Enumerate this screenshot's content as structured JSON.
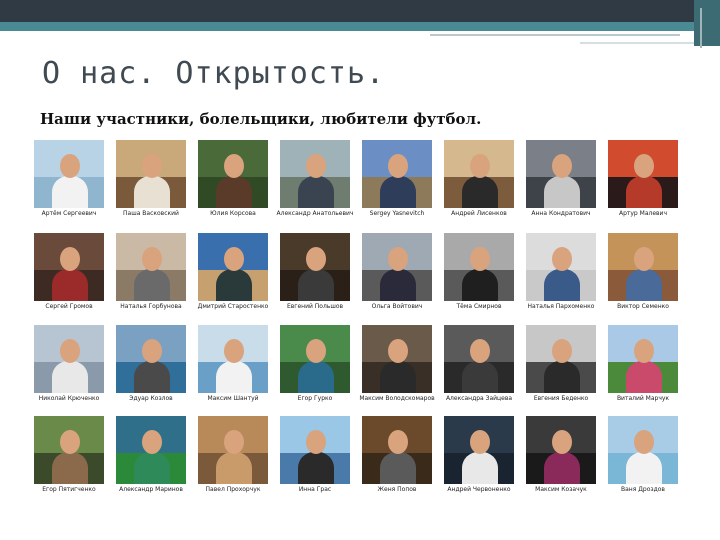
{
  "slide": {
    "title": "О нас. Открытость.",
    "subtitle": "Наши участники, болельщики, любители футбол."
  },
  "members": [
    {
      "name": "Артём Сергеевич",
      "sky": "#b8d3e6",
      "ground": "#8fb5cf",
      "shirt": "#f2f2f2"
    },
    {
      "name": "Паша Васковский",
      "sky": "#c9a97a",
      "ground": "#7a5a3a",
      "shirt": "#e8e1d3"
    },
    {
      "name": "Юлия Корсова",
      "sky": "#4a6a3a",
      "ground": "#2f4a24",
      "shirt": "#5a3b2a"
    },
    {
      "name": "Александр Анатольевич",
      "sky": "#9fb2b8",
      "ground": "#6f7d70",
      "shirt": "#3a4450"
    },
    {
      "name": "Sergey Yasnevitch",
      "sky": "#6b8fc4",
      "ground": "#8d7a5a",
      "shirt": "#2d3d5a"
    },
    {
      "name": "Андрей Лисенков",
      "sky": "#d6b88e",
      "ground": "#7d5b3d",
      "shirt": "#2a2a2a"
    },
    {
      "name": "Анна Кондратович",
      "sky": "#7a7f88",
      "ground": "#3e434a",
      "shirt": "#c7c7c7"
    },
    {
      "name": "Артур Малевич",
      "sky": "#d14b2e",
      "ground": "#2a1a1a",
      "shirt": "#b53a2a"
    },
    {
      "name": "Сергей Громов",
      "sky": "#6a4a3a",
      "ground": "#3d2a22",
      "shirt": "#9b2a2a"
    },
    {
      "name": "Наталья Горбунова",
      "sky": "#c9b9a5",
      "ground": "#8a7a66",
      "shirt": "#6a6a6a"
    },
    {
      "name": "Дмитрий Старостенко",
      "sky": "#3a6fae",
      "ground": "#c7a070",
      "shirt": "#2a3a3a"
    },
    {
      "name": "Евгений Польшов",
      "sky": "#4a3a2a",
      "ground": "#2a2018",
      "shirt": "#3a3a3a"
    },
    {
      "name": "Ольга Войтович",
      "sky": "#9fa9b3",
      "ground": "#5a5a5a",
      "shirt": "#2a2a3a"
    },
    {
      "name": "Тёма Смирнов",
      "sky": "#a9a9a9",
      "ground": "#5a5a5a",
      "shirt": "#1f1f1f"
    },
    {
      "name": "Наталья Пархоменко",
      "sky": "#dcdcdc",
      "ground": "#c9c9c9",
      "shirt": "#3a5a8a"
    },
    {
      "name": "Виктор Семенко",
      "sky": "#c4935a",
      "ground": "#8a5a3a",
      "shirt": "#4a6a9a"
    },
    {
      "name": "Николай Крюченко",
      "sky": "#b7c5d3",
      "ground": "#8a9aaa",
      "shirt": "#e8e8e8"
    },
    {
      "name": "Эдуар Козлов",
      "sky": "#7aa0c2",
      "ground": "#2f6f9a",
      "shirt": "#4a4a4a"
    },
    {
      "name": "Максим Шантуй",
      "sky": "#c9dce9",
      "ground": "#6aa0c7",
      "shirt": "#f2f2f2"
    },
    {
      "name": "Егор Гурко",
      "sky": "#4a8a4a",
      "ground": "#2f5a2f",
      "shirt": "#2a6a8a"
    },
    {
      "name": "Максим Володскомаров",
      "sky": "#6a5a4a",
      "ground": "#3a2f26",
      "shirt": "#2a2a2a"
    },
    {
      "name": "Александра Зайцева",
      "sky": "#5a5a5a",
      "ground": "#2a2a2a",
      "shirt": "#3a3a3a"
    },
    {
      "name": "Евгения Беденко",
      "sky": "#c7c7c7",
      "ground": "#4a4a4a",
      "shirt": "#2a2a2a"
    },
    {
      "name": "Виталий Марчук",
      "sky": "#a9c9e6",
      "ground": "#4a8a3a",
      "shirt": "#c94a6a"
    },
    {
      "name": "Егор Пятигченко",
      "sky": "#6a8a4a",
      "ground": "#3a4a2a",
      "shirt": "#8a6a4a"
    },
    {
      "name": "Александр Маринов",
      "sky": "#2f6f8a",
      "ground": "#2a8a3a",
      "shirt": "#2f8a5a"
    },
    {
      "name": "Павел Прохорчук",
      "sky": "#b88a5a",
      "ground": "#7a5a3a",
      "shirt": "#c99a6a"
    },
    {
      "name": "Инна Грас",
      "sky": "#9ac7e6",
      "ground": "#4a7aaa",
      "shirt": "#2a2a2a"
    },
    {
      "name": "Женя Попов",
      "sky": "#6a4a2a",
      "ground": "#3a2a1a",
      "shirt": "#5a5a5a"
    },
    {
      "name": "Андрей Червоненко",
      "sky": "#2a3a4a",
      "ground": "#1a2430",
      "shirt": "#e8e8e8"
    },
    {
      "name": "Максим Козачук",
      "sky": "#3a3a3a",
      "ground": "#1a1a1a",
      "shirt": "#8a2a5a"
    },
    {
      "name": "Ваня Дроздов",
      "sky": "#a9cce6",
      "ground": "#7ab6d6",
      "shirt": "#f2f2f2"
    }
  ],
  "icons": {
    "photo": "person-photo-icon"
  }
}
